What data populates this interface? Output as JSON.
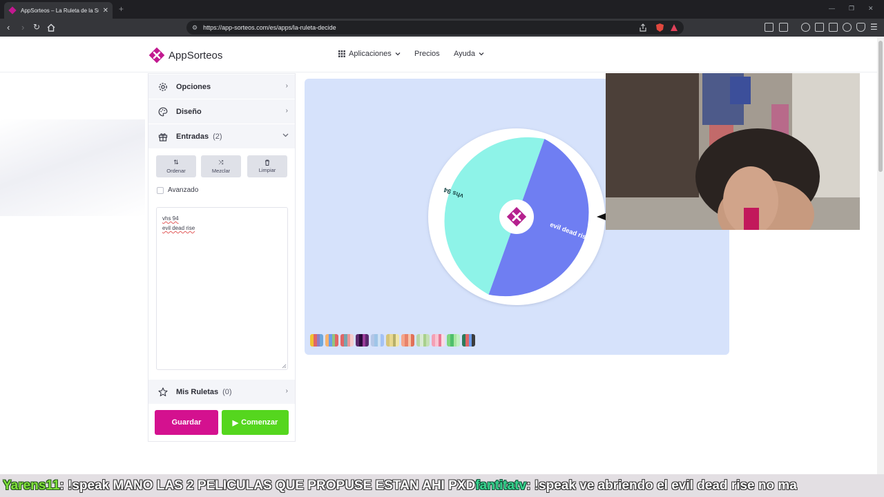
{
  "browser": {
    "tab_title": "AppSorteos – La Ruleta de la Su",
    "url": "https://app-sorteos.com/es/apps/la-ruleta-decide",
    "new_tab_symbol": "+",
    "close_symbol": "✕"
  },
  "header": {
    "brand": "AppSorteos",
    "menu": {
      "apps": "Aplicaciones",
      "prices": "Precios",
      "help": "Ayuda"
    }
  },
  "sidebar": {
    "options": "Opciones",
    "design": "Diseño",
    "entries": "Entradas",
    "entries_count": "(2)",
    "tools": {
      "sort": "Ordenar",
      "shuffle": "Mezclar",
      "clear": "Limpiar"
    },
    "advanced": "Avanzado",
    "entry_lines": [
      "vhs 94",
      "evil dead rise"
    ],
    "my_wheels": "Mis Ruletas",
    "my_wheels_count": "(0)"
  },
  "actions": {
    "save": "Guardar",
    "start": "Comenzar"
  },
  "wheel": {
    "segments": [
      {
        "label": "vhs 94",
        "color": "#8ef3e8"
      },
      {
        "label": "evil dead rise",
        "color": "#6f7ef2"
      }
    ],
    "center_color": "#b5208e",
    "background": "#d6e2fb"
  },
  "palettes": [
    [
      "#f1c232",
      "#e06666",
      "#8e7cc3",
      "#6fa8dc"
    ],
    [
      "#f6b26b",
      "#6d9eeb",
      "#93c47d",
      "#e06666"
    ],
    [
      "#e06666",
      "#76a5af",
      "#ea9999",
      "#f4cccc"
    ],
    [
      "#5b2a6e",
      "#2a0a3b",
      "#9b3d9b",
      "#5b2a6e"
    ],
    [
      "#b4c7e7",
      "#9fc5e8",
      "#cfe2f3",
      "#a4c2f4"
    ],
    [
      "#d5c47a",
      "#e8d88f",
      "#b7b06a",
      "#f1e6a7"
    ],
    [
      "#f4a58a",
      "#e8836b",
      "#f7c4a8",
      "#e07058"
    ],
    [
      "#b6d7a8",
      "#d9ead3",
      "#a8d08d",
      "#c5e0b4"
    ],
    [
      "#f4a0b5",
      "#f8c6d3",
      "#e97a98",
      "#fadce4"
    ],
    [
      "#7ed67e",
      "#4fbf6b",
      "#a8e6a1",
      "#c2f0c2"
    ],
    [
      "#2d7a5b",
      "#e06666",
      "#6d9eeb",
      "#3c3c3c"
    ]
  ],
  "chat": {
    "user1": "Yarens11",
    "msg1": " : !speak MANO LAS 2 PELICULAS QUE PROPUSE ESTAN AHI PXD ",
    "user2": "fantitatv",
    "msg2": " : !speak ve abriendo el evil dead rise no ma"
  }
}
